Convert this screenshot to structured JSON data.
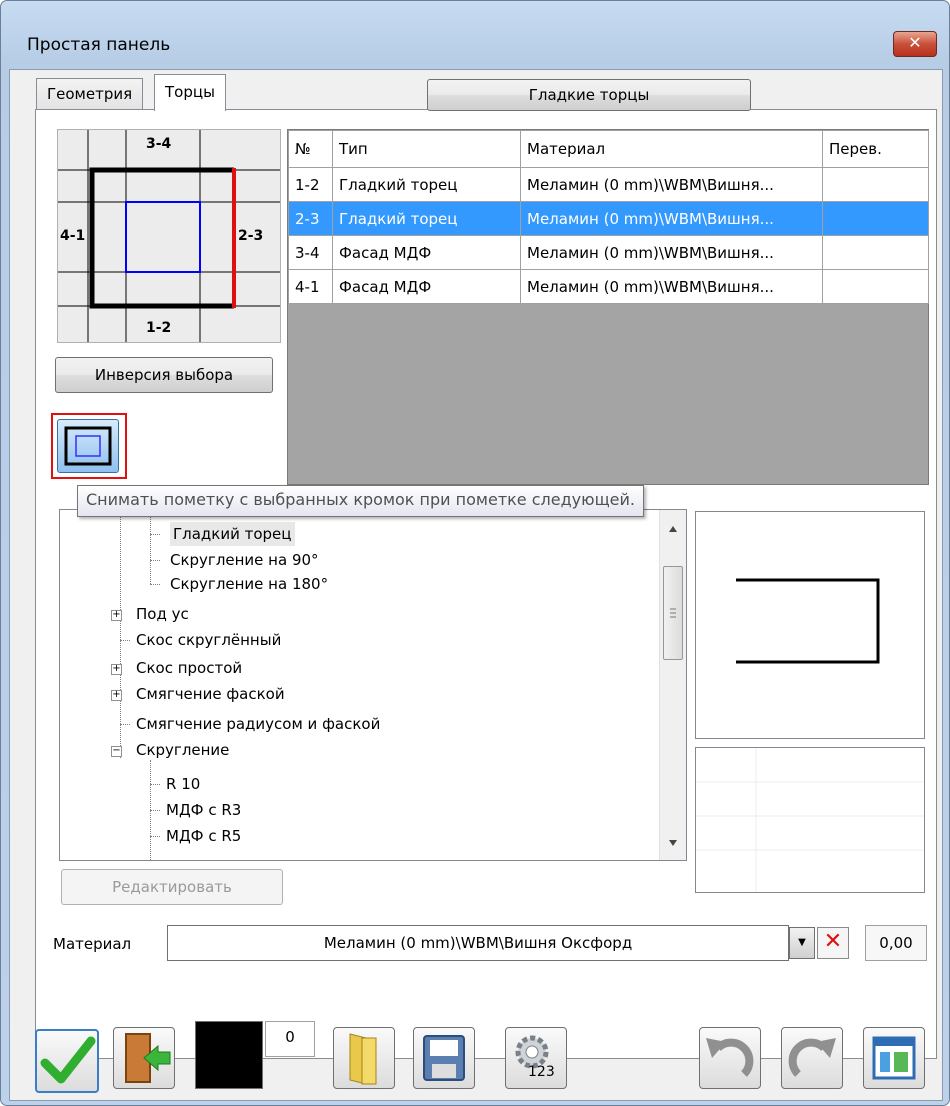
{
  "window": {
    "title": "Простая панель",
    "close_glyph": "✕"
  },
  "tabs": [
    {
      "label": "Геометрия",
      "active": false
    },
    {
      "label": "Торцы",
      "active": true
    }
  ],
  "top_button": {
    "label": "Гладкие торцы"
  },
  "edge_diagram": {
    "top": "3-4",
    "left": "4-1",
    "right": "2-3",
    "bottom": "1-2",
    "highlight_color": "#e01010",
    "frame_color": "#0000ff"
  },
  "invert_button": {
    "label": "Инверсия выбора"
  },
  "toggle_button": {
    "icon": "frame-select-icon",
    "highlight": "#e01010"
  },
  "tooltip": {
    "text": "Снимать пометку с выбранных кромок при пометке следующей."
  },
  "edge_table": {
    "headers": [
      "№",
      "Тип",
      "Материал",
      "Перев."
    ],
    "rows": [
      {
        "num": "1-2",
        "type": "Гладкий торец",
        "material": "Меламин (0 mm)\\WBM\\Вишня...",
        "rev": "",
        "selected": false
      },
      {
        "num": "2-3",
        "type": "Гладкий торец",
        "material": "Меламин (0 mm)\\WBM\\Вишня...",
        "rev": "",
        "selected": true
      },
      {
        "num": "3-4",
        "type": "Фасад МДФ",
        "material": "Меламин (0 mm)\\WBM\\Вишня...",
        "rev": "",
        "selected": false
      },
      {
        "num": "4-1",
        "type": "Фасад МДФ",
        "material": "Меламин (0 mm)\\WBM\\Вишня...",
        "rev": "",
        "selected": false
      }
    ],
    "selection_color": "#3399ff"
  },
  "tree": {
    "items": [
      {
        "label": "Гладкий торец",
        "selected": true
      },
      {
        "label": "Скругление на 90°"
      },
      {
        "label": "Скругление на 180°"
      },
      {
        "label": "Под ус",
        "expander": "+"
      },
      {
        "label": "Скос скруглённый"
      },
      {
        "label": "Скос простой",
        "expander": "+"
      },
      {
        "label": "Смягчение фаской",
        "expander": "+"
      },
      {
        "label": "Смягчение радиусом и фаской"
      },
      {
        "label": "Скругление",
        "expander": "−"
      },
      {
        "label": "R 10"
      },
      {
        "label": "МДФ с R3"
      },
      {
        "label": "МДФ с R5"
      }
    ]
  },
  "edit_button": {
    "label": "Редактировать"
  },
  "material": {
    "label": "Материал",
    "value": "Меламин (0 mm)\\WBM\\Вишня Оксфорд",
    "dropdown_glyph": "▼",
    "clear_glyph": "✕",
    "number": "0,00"
  },
  "toolbar": {
    "ok_icon": "checkmark-icon",
    "exit_icon": "exit-door-icon",
    "color_swatch": "#000000",
    "counter": "0",
    "open_icon": "folder-icon",
    "save_icon": "floppy-disk-icon",
    "settings_icon": "gear-icon",
    "settings_badge": "123",
    "undo_icon": "undo-icon",
    "redo_icon": "redo-icon",
    "view_icon": "window-layout-icon"
  }
}
